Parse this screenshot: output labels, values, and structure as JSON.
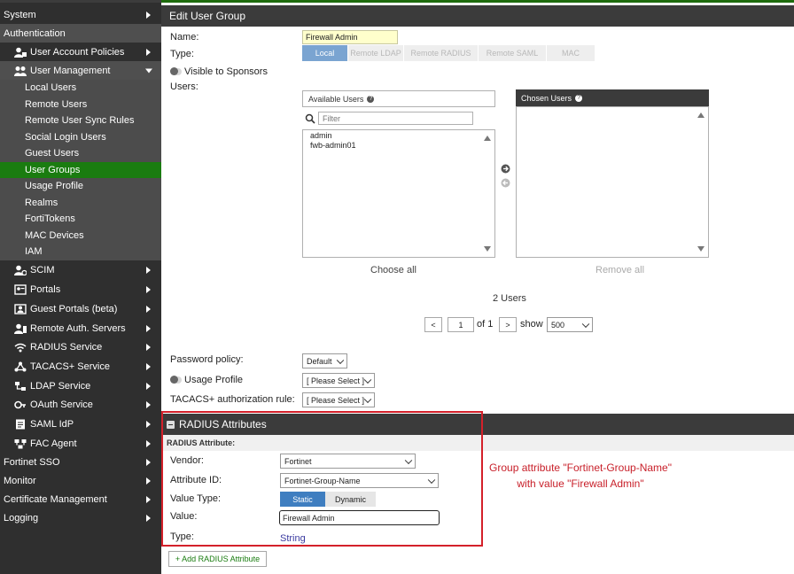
{
  "sidebar": {
    "items": [
      {
        "label": "System",
        "level": 0,
        "arrow": "right",
        "icon": ""
      },
      {
        "label": "Authentication",
        "level": 0,
        "arrow": "none",
        "icon": ""
      },
      {
        "label": "User Account Policies",
        "level": 1,
        "arrow": "right",
        "icon": "user-lock-icon"
      },
      {
        "label": "User Management",
        "level": 1,
        "arrow": "down",
        "icon": "users-icon"
      },
      {
        "label": "Local Users",
        "level": 2,
        "arrow": "none",
        "icon": ""
      },
      {
        "label": "Remote Users",
        "level": 2,
        "arrow": "none",
        "icon": ""
      },
      {
        "label": "Remote User Sync Rules",
        "level": 2,
        "arrow": "none",
        "icon": ""
      },
      {
        "label": "Social Login Users",
        "level": 2,
        "arrow": "none",
        "icon": ""
      },
      {
        "label": "Guest Users",
        "level": 2,
        "arrow": "none",
        "icon": ""
      },
      {
        "label": "User Groups",
        "level": 2,
        "arrow": "none",
        "icon": "",
        "selected": true
      },
      {
        "label": "Usage Profile",
        "level": 2,
        "arrow": "none",
        "icon": ""
      },
      {
        "label": "Realms",
        "level": 2,
        "arrow": "none",
        "icon": ""
      },
      {
        "label": "FortiTokens",
        "level": 2,
        "arrow": "none",
        "icon": ""
      },
      {
        "label": "MAC Devices",
        "level": 2,
        "arrow": "none",
        "icon": ""
      },
      {
        "label": "IAM",
        "level": 2,
        "arrow": "none",
        "icon": ""
      },
      {
        "label": "SCIM",
        "level": 1,
        "arrow": "right",
        "icon": "user-gear-icon"
      },
      {
        "label": "Portals",
        "level": 1,
        "arrow": "right",
        "icon": "portal-icon"
      },
      {
        "label": "Guest Portals (beta)",
        "level": 1,
        "arrow": "right",
        "icon": "guest-portal-icon"
      },
      {
        "label": "Remote Auth. Servers",
        "level": 1,
        "arrow": "right",
        "icon": "server-user-icon"
      },
      {
        "label": "RADIUS Service",
        "level": 1,
        "arrow": "right",
        "icon": "wifi-icon"
      },
      {
        "label": "TACACS+ Service",
        "level": 1,
        "arrow": "right",
        "icon": "network-icon"
      },
      {
        "label": "LDAP Service",
        "level": 1,
        "arrow": "right",
        "icon": "ldap-tree-icon"
      },
      {
        "label": "OAuth Service",
        "level": 1,
        "arrow": "right",
        "icon": "oauth-icon"
      },
      {
        "label": "SAML IdP",
        "level": 1,
        "arrow": "right",
        "icon": "saml-icon"
      },
      {
        "label": "FAC Agent",
        "level": 1,
        "arrow": "right",
        "icon": "agent-icon"
      },
      {
        "label": "Fortinet SSO",
        "level": 0,
        "arrow": "right",
        "icon": ""
      },
      {
        "label": "Monitor",
        "level": 0,
        "arrow": "right",
        "icon": ""
      },
      {
        "label": "Certificate Management",
        "level": 0,
        "arrow": "right",
        "icon": ""
      },
      {
        "label": "Logging",
        "level": 0,
        "arrow": "right",
        "icon": ""
      }
    ]
  },
  "header": {
    "title": "Edit User Group"
  },
  "form": {
    "name_label": "Name:",
    "name_value": "Firewall Admin",
    "type_label": "Type:",
    "type_options": [
      "Local",
      "Remote LDAP",
      "Remote RADIUS",
      "Remote SAML",
      "MAC"
    ],
    "visible_label": "Visible to Sponsors",
    "users_label": "Users:"
  },
  "users_picker": {
    "available_title": "Available Users",
    "filter_placeholder": "Filter",
    "available_users": [
      "admin",
      "fwb-admin01"
    ],
    "chosen_title": "Chosen Users",
    "choose_all": "Choose all",
    "remove_all": "Remove all",
    "count_text": "2 Users",
    "page_value": "1",
    "of_text": "of 1",
    "show_text": "show",
    "page_size": "500",
    "prev": "<",
    "next": ">"
  },
  "settings": {
    "password_policy_label": "Password policy:",
    "password_policy_value": "Default",
    "usage_profile_label": "Usage Profile",
    "usage_profile_value": "[ Please Select ]",
    "tacacs_label": "TACACS+ authorization rule:",
    "tacacs_value": "[ Please Select ]"
  },
  "radius": {
    "section_title": "RADIUS Attributes",
    "sub_title": "RADIUS Attribute:",
    "vendor_label": "Vendor:",
    "vendor_value": "Fortinet",
    "attr_id_label": "Attribute ID:",
    "attr_id_value": "Fortinet-Group-Name",
    "value_type_label": "Value Type:",
    "value_type_options": [
      "Static",
      "Dynamic"
    ],
    "value_label": "Value:",
    "value_value": "Firewall Admin",
    "type_label": "Type:",
    "type_value": "String",
    "add_button": "+ Add RADIUS Attribute"
  },
  "annotation": {
    "text": "Group attribute \"Fortinet-Group-Name\" with value \"Firewall Admin\""
  },
  "colors": {
    "accent_green": "#1a7c10",
    "annotation_red": "#d4202a",
    "static_blue": "#3f7ec0",
    "link_blue": "#3a3aa0"
  }
}
